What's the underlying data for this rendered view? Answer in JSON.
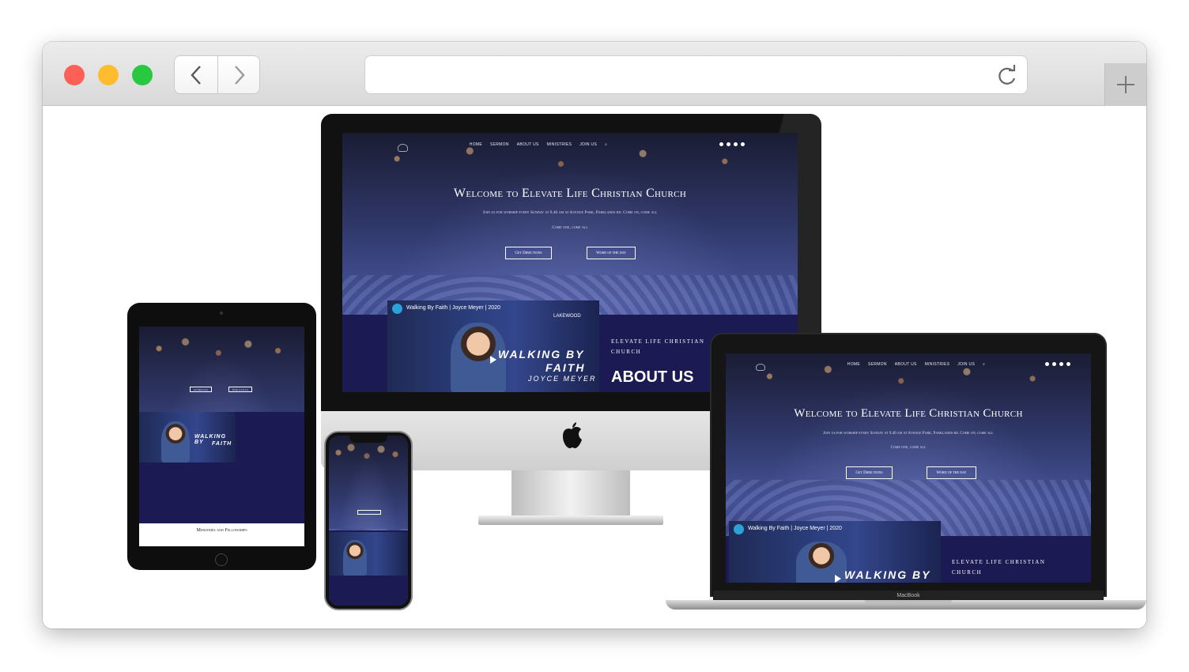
{
  "browser": {
    "traffic_lights": {
      "close": "#fe5f57",
      "minimize": "#febc2e",
      "zoom": "#28c840"
    },
    "back_icon": "chevron-left-icon",
    "forward_icon": "chevron-right-icon",
    "url": "",
    "reload_icon": "reload-icon",
    "new_tab_icon": "plus-icon"
  },
  "site": {
    "nav": [
      "HOME",
      "SERMON",
      "ABOUT US",
      "MINISTRIES",
      "JOIN US"
    ],
    "search_icon": "search-icon",
    "social_icons": [
      "twitter-icon",
      "facebook-icon",
      "instagram-icon",
      "youtube-icon"
    ],
    "hero_title": "Welcome to Elevate Life Christian Church",
    "hero_sub": "Join us for worship every Sunday at 9.40 am at Avenue Park, Parklands rd. Come on, come all",
    "hero_sub2": "Come one, come all",
    "btn_directions": "Get Directions",
    "btn_word": "Word of the day",
    "video_title": "Walking By Faith | Joyce Meyer | 2020",
    "video_text1": "WALKING BY",
    "video_text2": "FAITH",
    "video_text3": "JOYCE MEYER",
    "video_brand": "LAKEWOOD",
    "about_small": "ELEVATE LIFE CHRISTIAN CHURCH",
    "about_big": "ABOUT US",
    "ipad_footer": "Ministries and Fellowships"
  },
  "macbook_label": "MacBook",
  "colors": {
    "band": "#1c1a52",
    "accent": "#2aa2d8"
  }
}
